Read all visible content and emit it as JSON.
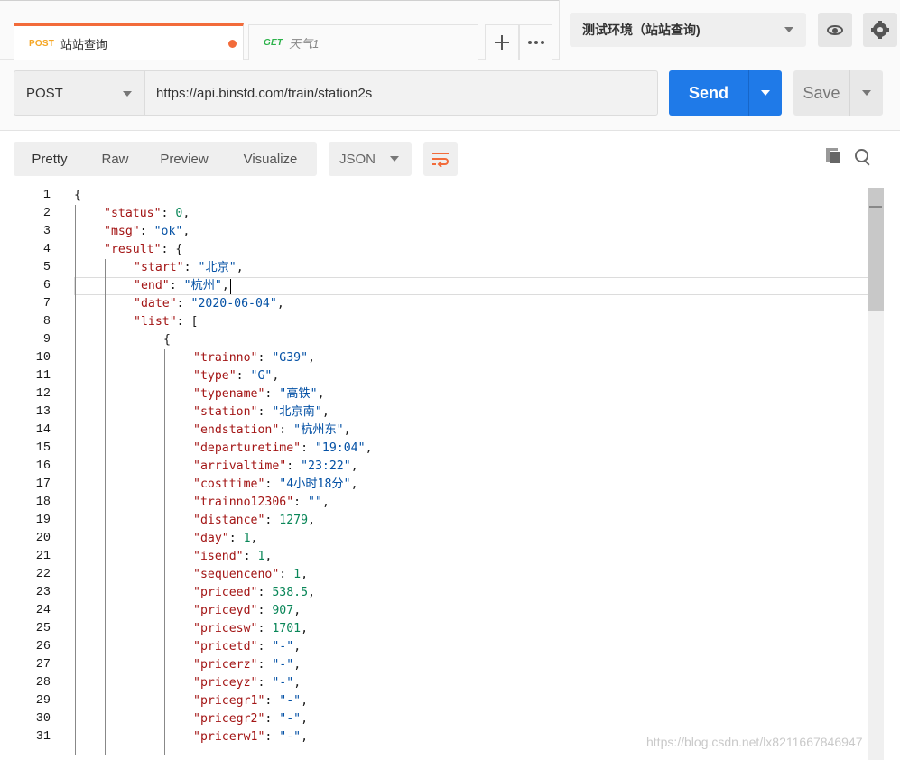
{
  "tabs": [
    {
      "method": "POST",
      "title": "站站查询",
      "unsaved": true
    },
    {
      "method": "GET",
      "title": "天气1",
      "unsaved": false
    }
  ],
  "environment": {
    "selected": "测试环境（站站查询)"
  },
  "request": {
    "method": "POST",
    "url": "https://api.binstd.com/train/station2s",
    "send_label": "Send",
    "save_label": "Save"
  },
  "response": {
    "view_tabs": [
      "Pretty",
      "Raw",
      "Preview",
      "Visualize"
    ],
    "format": "JSON",
    "lines": [
      [
        [
          "p",
          "{"
        ]
      ],
      [
        [
          "k",
          "\"status\""
        ],
        [
          "p",
          ": "
        ],
        [
          "n",
          "0"
        ],
        [
          "p",
          ","
        ]
      ],
      [
        [
          "k",
          "\"msg\""
        ],
        [
          "p",
          ": "
        ],
        [
          "s",
          "\"ok\""
        ],
        [
          "p",
          ","
        ]
      ],
      [
        [
          "k",
          "\"result\""
        ],
        [
          "p",
          ": {"
        ]
      ],
      [
        [
          "k",
          "\"start\""
        ],
        [
          "p",
          ": "
        ],
        [
          "s",
          "\"北京\""
        ],
        [
          "p",
          ","
        ]
      ],
      [
        [
          "k",
          "\"end\""
        ],
        [
          "p",
          ": "
        ],
        [
          "s",
          "\"杭州\""
        ],
        [
          "p",
          ","
        ]
      ],
      [
        [
          "k",
          "\"date\""
        ],
        [
          "p",
          ": "
        ],
        [
          "s",
          "\"2020-06-04\""
        ],
        [
          "p",
          ","
        ]
      ],
      [
        [
          "k",
          "\"list\""
        ],
        [
          "p",
          ": ["
        ]
      ],
      [
        [
          "p",
          "{"
        ]
      ],
      [
        [
          "k",
          "\"trainno\""
        ],
        [
          "p",
          ": "
        ],
        [
          "s",
          "\"G39\""
        ],
        [
          "p",
          ","
        ]
      ],
      [
        [
          "k",
          "\"type\""
        ],
        [
          "p",
          ": "
        ],
        [
          "s",
          "\"G\""
        ],
        [
          "p",
          ","
        ]
      ],
      [
        [
          "k",
          "\"typename\""
        ],
        [
          "p",
          ": "
        ],
        [
          "s",
          "\"高铁\""
        ],
        [
          "p",
          ","
        ]
      ],
      [
        [
          "k",
          "\"station\""
        ],
        [
          "p",
          ": "
        ],
        [
          "s",
          "\"北京南\""
        ],
        [
          "p",
          ","
        ]
      ],
      [
        [
          "k",
          "\"endstation\""
        ],
        [
          "p",
          ": "
        ],
        [
          "s",
          "\"杭州东\""
        ],
        [
          "p",
          ","
        ]
      ],
      [
        [
          "k",
          "\"departuretime\""
        ],
        [
          "p",
          ": "
        ],
        [
          "s",
          "\"19:04\""
        ],
        [
          "p",
          ","
        ]
      ],
      [
        [
          "k",
          "\"arrivaltime\""
        ],
        [
          "p",
          ": "
        ],
        [
          "s",
          "\"23:22\""
        ],
        [
          "p",
          ","
        ]
      ],
      [
        [
          "k",
          "\"costtime\""
        ],
        [
          "p",
          ": "
        ],
        [
          "s",
          "\"4小时18分\""
        ],
        [
          "p",
          ","
        ]
      ],
      [
        [
          "k",
          "\"trainno12306\""
        ],
        [
          "p",
          ": "
        ],
        [
          "s",
          "\"\""
        ],
        [
          "p",
          ","
        ]
      ],
      [
        [
          "k",
          "\"distance\""
        ],
        [
          "p",
          ": "
        ],
        [
          "n",
          "1279"
        ],
        [
          "p",
          ","
        ]
      ],
      [
        [
          "k",
          "\"day\""
        ],
        [
          "p",
          ": "
        ],
        [
          "n",
          "1"
        ],
        [
          "p",
          ","
        ]
      ],
      [
        [
          "k",
          "\"isend\""
        ],
        [
          "p",
          ": "
        ],
        [
          "n",
          "1"
        ],
        [
          "p",
          ","
        ]
      ],
      [
        [
          "k",
          "\"sequenceno\""
        ],
        [
          "p",
          ": "
        ],
        [
          "n",
          "1"
        ],
        [
          "p",
          ","
        ]
      ],
      [
        [
          "k",
          "\"priceed\""
        ],
        [
          "p",
          ": "
        ],
        [
          "n",
          "538.5"
        ],
        [
          "p",
          ","
        ]
      ],
      [
        [
          "k",
          "\"priceyd\""
        ],
        [
          "p",
          ": "
        ],
        [
          "n",
          "907"
        ],
        [
          "p",
          ","
        ]
      ],
      [
        [
          "k",
          "\"pricesw\""
        ],
        [
          "p",
          ": "
        ],
        [
          "n",
          "1701"
        ],
        [
          "p",
          ","
        ]
      ],
      [
        [
          "k",
          "\"pricetd\""
        ],
        [
          "p",
          ": "
        ],
        [
          "s",
          "\"-\""
        ],
        [
          "p",
          ","
        ]
      ],
      [
        [
          "k",
          "\"pricerz\""
        ],
        [
          "p",
          ": "
        ],
        [
          "s",
          "\"-\""
        ],
        [
          "p",
          ","
        ]
      ],
      [
        [
          "k",
          "\"priceyz\""
        ],
        [
          "p",
          ": "
        ],
        [
          "s",
          "\"-\""
        ],
        [
          "p",
          ","
        ]
      ],
      [
        [
          "k",
          "\"pricegr1\""
        ],
        [
          "p",
          ": "
        ],
        [
          "s",
          "\"-\""
        ],
        [
          "p",
          ","
        ]
      ],
      [
        [
          "k",
          "\"pricegr2\""
        ],
        [
          "p",
          ": "
        ],
        [
          "s",
          "\"-\""
        ],
        [
          "p",
          ","
        ]
      ],
      [
        [
          "k",
          "\"pricerw1\""
        ],
        [
          "p",
          ": "
        ],
        [
          "s",
          "\"-\""
        ],
        [
          "p",
          ","
        ]
      ]
    ],
    "indent_levels": [
      0,
      1,
      1,
      1,
      2,
      2,
      2,
      2,
      3,
      4,
      4,
      4,
      4,
      4,
      4,
      4,
      4,
      4,
      4,
      4,
      4,
      4,
      4,
      4,
      4,
      4,
      4,
      4,
      4,
      4,
      4
    ]
  },
  "watermark": "https://blog.csdn.net/lx8211667846947",
  "colors": {
    "accent": "#f26b3a",
    "send": "#1f7ae8",
    "json_key": "#a31515",
    "json_string": "#0451a5",
    "json_number": "#098658"
  }
}
